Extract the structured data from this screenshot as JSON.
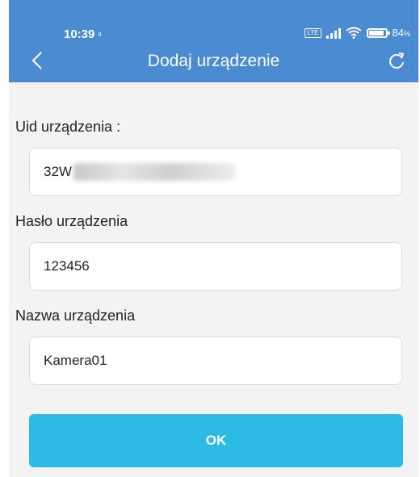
{
  "status_bar": {
    "time": "10:39",
    "sync_glyph": "ᵃ",
    "network_badge": "LTE",
    "battery_level": "84",
    "battery_unit": "%"
  },
  "header": {
    "title": "Dodaj urządzenie",
    "back_icon": "chevron-left-icon",
    "refresh_icon": "refresh-icon"
  },
  "form": {
    "uid_label": "Uid urządzenia :",
    "uid_value": "32W",
    "password_label": "Hasło urządzenia",
    "password_value": "123456",
    "name_label": "Nazwa urządzenia",
    "name_value": "Kamera01"
  },
  "ok_button": "OK",
  "colors": {
    "header": "#4a8bd2",
    "button": "#2bbbe5",
    "background": "#f3f3f3"
  }
}
